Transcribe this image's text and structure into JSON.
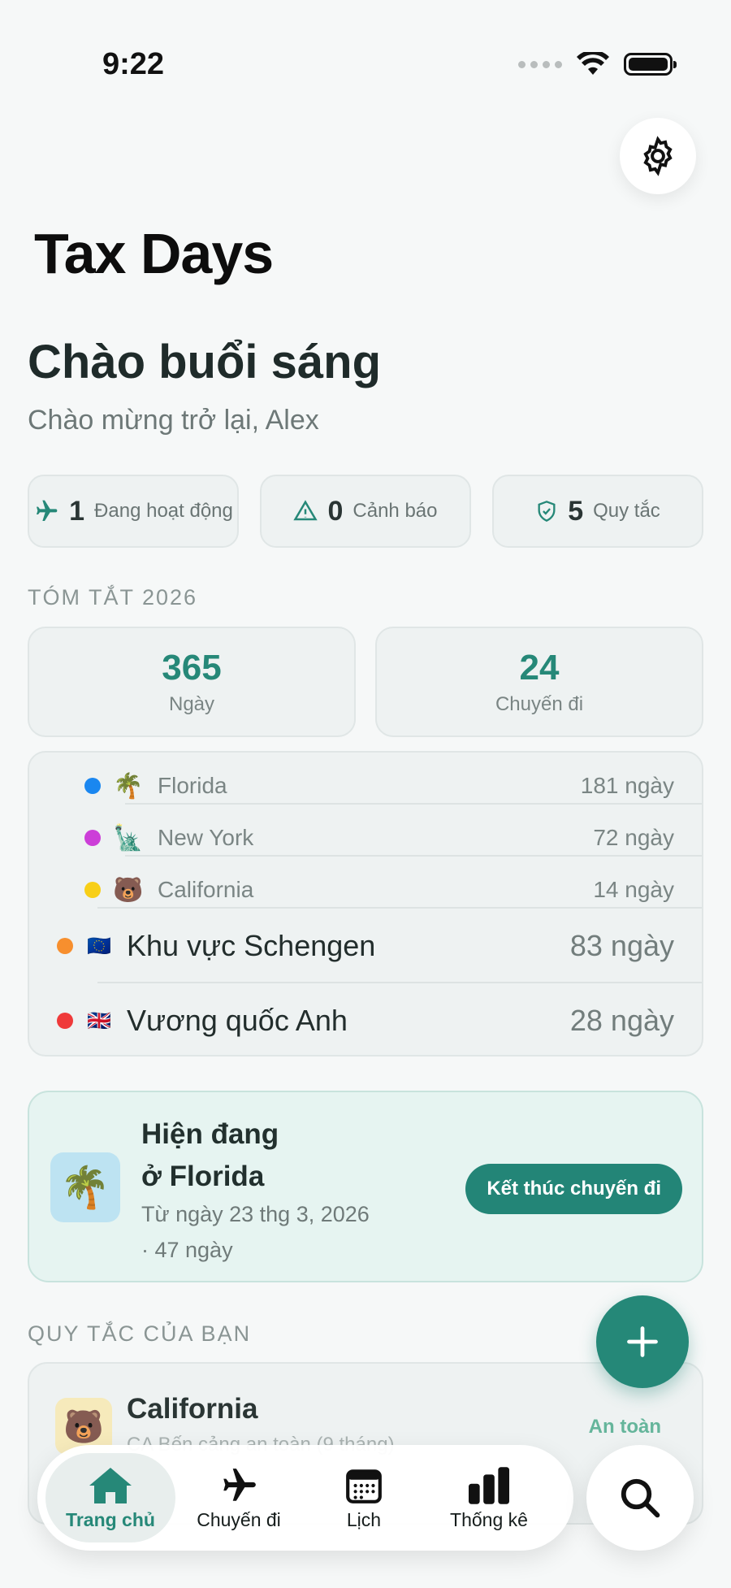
{
  "status_bar": {
    "time": "9:22"
  },
  "app_title": "Tax Days",
  "greeting": "Chào buổi sáng",
  "subgreeting": "Chào mừng trở lại, Alex",
  "chips": [
    {
      "icon": "airplane-icon",
      "count": "1",
      "label": "Đang hoạt động"
    },
    {
      "icon": "warning-icon",
      "count": "0",
      "label": "Cảnh báo"
    },
    {
      "icon": "shield-icon",
      "count": "5",
      "label": "Quy tắc"
    }
  ],
  "summary": {
    "title": "TÓM TẮT 2026",
    "days_value": "365",
    "days_label": "Ngày",
    "trips_value": "24",
    "trips_label": "Chuyến đi"
  },
  "regions": [
    {
      "dot_color": "#1a87f0",
      "emoji": "🌴",
      "name": "Florida",
      "days": "181 ngày"
    },
    {
      "dot_color": "#cc3fd8",
      "emoji": "🗽",
      "name": "New York",
      "days": "72 ngày"
    },
    {
      "dot_color": "#f8cf17",
      "emoji": "🐻",
      "name": "California",
      "days": "14 ngày"
    },
    {
      "dot_color": "#f78f2e",
      "emoji": "🇪🇺",
      "name": "Khu vực Schengen",
      "days": "83 ngày"
    },
    {
      "dot_color": "#ef3a3a",
      "emoji": "🇬🇧",
      "name": "Vương quốc Anh",
      "days": "28 ngày"
    }
  ],
  "current_trip": {
    "emoji": "🌴",
    "title_line1": "Hiện đang",
    "title_line2": "ở Florida",
    "since": "Từ ngày 23 thg 3, 2026",
    "duration": "· 47 ngày",
    "end_button": "Kết thúc chuyến đi"
  },
  "rules": {
    "title": "QUY TẮC CỦA BẠN",
    "items": [
      {
        "emoji": "🐻",
        "name": "California",
        "desc": "CA Bến cảng an toàn (9 tháng)",
        "status": "An toàn"
      }
    ]
  },
  "tabbar": {
    "tabs": [
      {
        "icon": "home-icon",
        "label": "Trang chủ",
        "active": true
      },
      {
        "icon": "airplane-icon",
        "label": "Chuyến đi",
        "active": false
      },
      {
        "icon": "calendar-icon",
        "label": "Lịch",
        "active": false
      },
      {
        "icon": "bar-chart-icon",
        "label": "Thống kê",
        "active": false
      }
    ]
  },
  "colors": {
    "accent": "#268878",
    "background": "#f6f8f8"
  }
}
